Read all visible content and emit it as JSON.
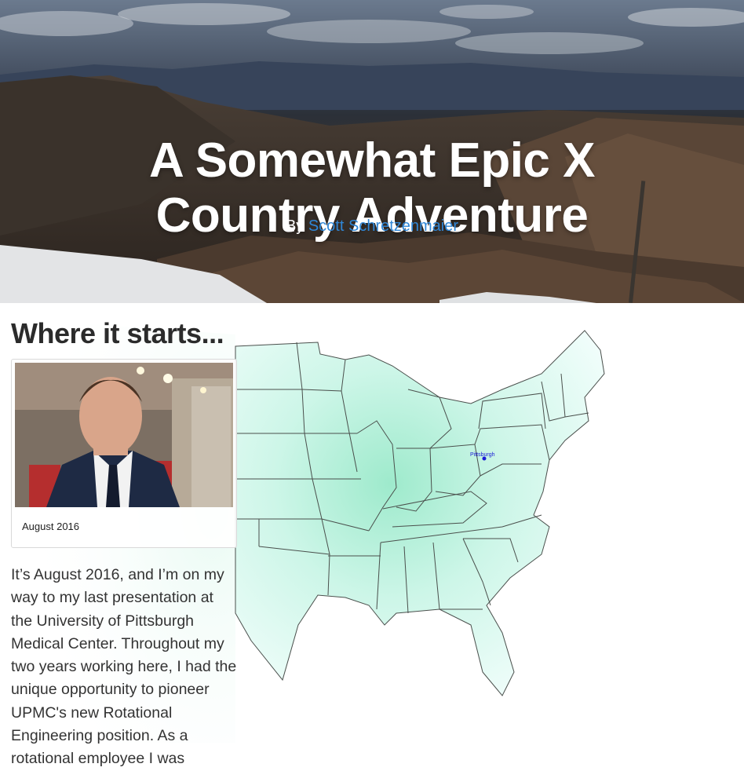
{
  "hero": {
    "title_line1": "A Somewhat Epic X",
    "title_line2": "Country Adventure",
    "byline_prefix": "By",
    "author": "Scott Schretzenmaier"
  },
  "section": {
    "title": "Where it starts..."
  },
  "photo_card": {
    "caption": "August 2016"
  },
  "story": {
    "text": "It’s August 2016, and I’m on my way to my last presentation at the University of Pittsburgh Medical Center. Throughout my two years working here, I had the unique opportunity to pioneer UPMC's new Rotational Engineering position. As a rotational employee I was"
  },
  "map": {
    "marker_label": "Pittsburgh"
  },
  "colors": {
    "link": "#2f86d6",
    "map_fill_light": "#eefcf9",
    "map_fill_dark": "#9eeacc",
    "state_stroke": "#4a4f4c",
    "marker": "#1a1ad6"
  }
}
